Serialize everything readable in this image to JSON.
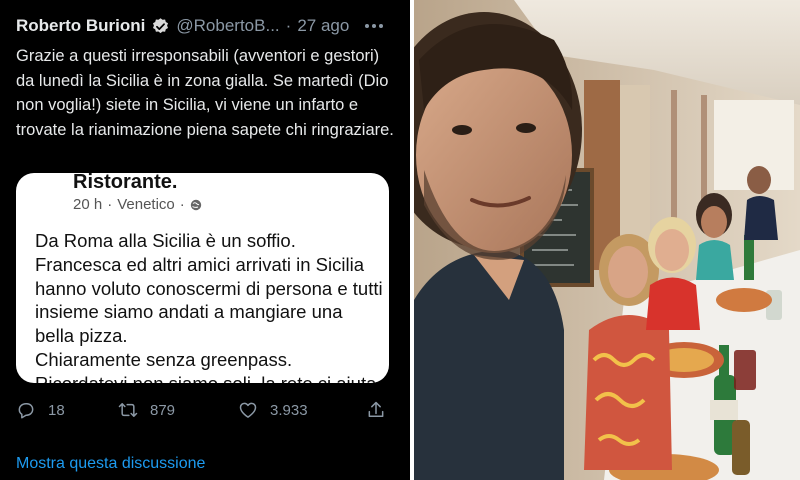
{
  "tweet": {
    "author_name": "Roberto Burioni",
    "handle": "@RobertoB...",
    "separator": "·",
    "time": "27 ago",
    "verified_icon": "verified-badge-icon",
    "more_icon": "more-options-icon",
    "text": "Grazie a questi irresponsabili (avventori e gestori) da lunedì la Sicilia è in zona gialla. Se martedì (Dio non voglia!) siete in Sicilia, vi viene un infarto e trovate la rianimazione piena sapete chi ringraziare.",
    "quoted_post": {
      "page_name": "Ristorante.",
      "time": "20 h",
      "location": "Venetico",
      "separator": "·",
      "body": "Da Roma alla Sicilia è un soffio.\nFrancesca ed altri amici arrivati in Sicilia hanno voluto conoscermi di persona e tutti insieme siamo andati a mangiare una bella pizza.\nChiaramente senza greenpass.\nRicordatevi non siamo soli, la rete ci aiuta"
    },
    "actions": {
      "replies": "18",
      "retweets": "879",
      "likes": "3.933"
    },
    "show_thread": "Mostra questa discussione",
    "colors": {
      "background": "#000000",
      "text": "#e7e9ea",
      "muted": "#8b98a5",
      "link": "#1d9bf0"
    }
  }
}
